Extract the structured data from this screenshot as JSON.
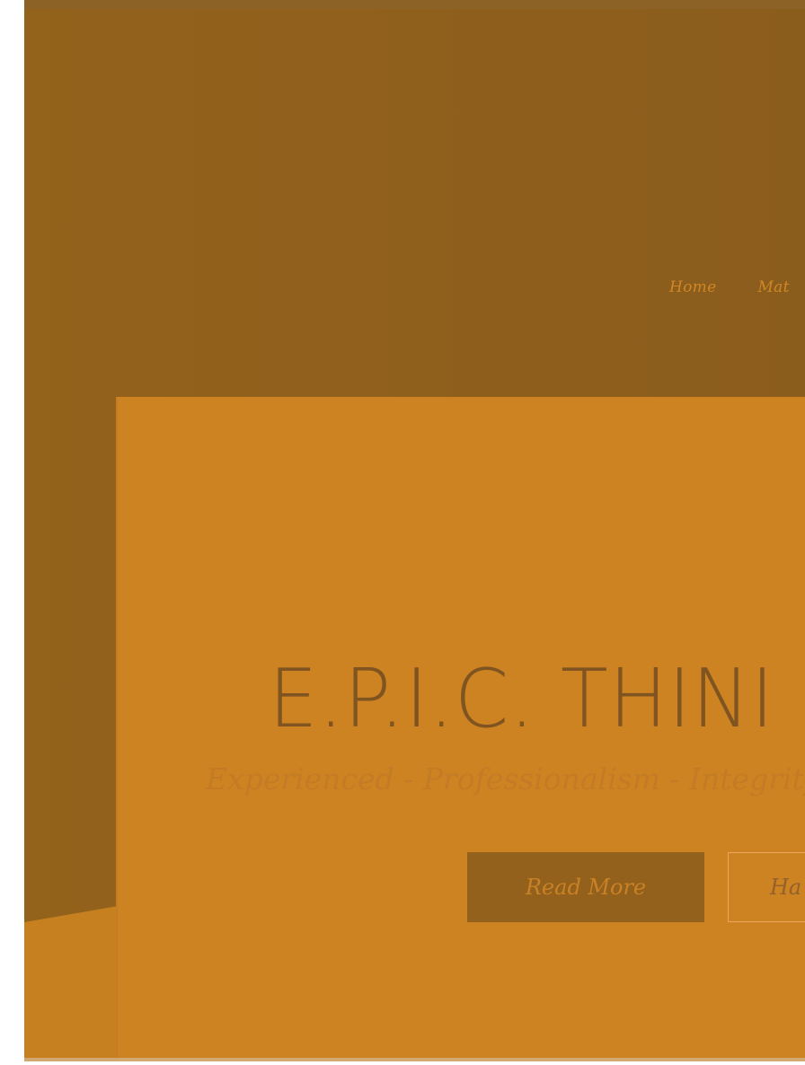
{
  "nav": {
    "items": [
      {
        "label": "Home"
      },
      {
        "label": "Mat"
      }
    ]
  },
  "hero": {
    "title": "E.P.I.C. THINI",
    "tagline": "Experienced - Professionalism - Integrity",
    "primary_button": "Read More",
    "secondary_button": "Ha"
  },
  "colors": {
    "header_bg": "#93631c",
    "panel_bg": "#cd8322",
    "accent": "#d08624",
    "title_text": "#7f5420"
  }
}
